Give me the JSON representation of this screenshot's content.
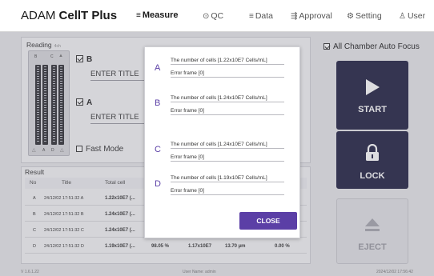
{
  "app": {
    "brand_prefix": "ADAM ",
    "brand_name": "CellT Plus"
  },
  "nav": {
    "items": [
      {
        "label": "Measure",
        "icon": "list-icon",
        "glyph": "≡"
      },
      {
        "label": "QC",
        "icon": "shield-icon",
        "glyph": "⊙"
      },
      {
        "label": "Data",
        "icon": "list-icon",
        "glyph": "≡"
      },
      {
        "label": "Approval",
        "icon": "approval-icon",
        "glyph": "⇶"
      },
      {
        "label": "Setting",
        "icon": "gear-icon",
        "glyph": "⚙"
      },
      {
        "label": "User",
        "icon": "user-icon",
        "glyph": "♙"
      }
    ]
  },
  "reading": {
    "title": "Reading",
    "sub": "4ch",
    "chip_letters": {
      "b": "B",
      "c": "C",
      "a": "A",
      "d": "D"
    },
    "channel_b": {
      "label": "B",
      "title": "ENTER TITLE",
      "checked": true
    },
    "channel_a": {
      "label": "A",
      "title": "ENTER TITLE",
      "checked": true
    },
    "fast_mode": "Fast Mode"
  },
  "result": {
    "title": "Result",
    "columns": [
      "No",
      "Title",
      "Total cell"
    ],
    "rows": [
      {
        "no": "A",
        "time": "24/12/02 17:51:32 A",
        "total": "1.22x10E7 (...",
        "viability": "",
        "live": "",
        "size": "",
        "dead": ""
      },
      {
        "no": "B",
        "time": "24/12/02 17:51:32 B",
        "total": "1.24x10E7 (...",
        "viability": "",
        "live": "",
        "size": "",
        "dead": ""
      },
      {
        "no": "C",
        "time": "24/12/02 17:51:32 C",
        "total": "1.24x10E7 (...",
        "viability": "",
        "live": "",
        "size": "",
        "dead": ""
      },
      {
        "no": "D",
        "time": "24/12/02 17:51:32 D",
        "total": "1.19x10E7 (...",
        "viability": "98.05 %",
        "live": "1.17x10E7",
        "size": "13.70 µm",
        "dead": "0.00 %"
      }
    ]
  },
  "right": {
    "auto_focus": "All Chamber Auto Focus",
    "start": "START",
    "lock": "LOCK",
    "eject": "EJECT"
  },
  "modal": {
    "entries": [
      {
        "letter": "A",
        "cells": "The number of cells [1.22x10E7 Cells/mL]",
        "error": "Error frame [0]"
      },
      {
        "letter": "B",
        "cells": "The number of cells [1.24x10E7 Cells/mL]",
        "error": "Error frame [0]"
      },
      {
        "letter": "C",
        "cells": "The number of cells [1.24x10E7 Cells/mL]",
        "error": "Error frame [0]"
      },
      {
        "letter": "D",
        "cells": "The number of cells [1.19x10E7 Cells/mL]",
        "error": "Error frame [0]"
      }
    ],
    "close": "CLOSE"
  },
  "footer": {
    "version": "V 1.6.1.22",
    "user": "User Name: admin",
    "datetime": "2024/12/02 17:56:42"
  },
  "colors": {
    "accent": "#5b3fa6",
    "dark_button": "#1f1f40",
    "background": "#e7e7ea"
  }
}
